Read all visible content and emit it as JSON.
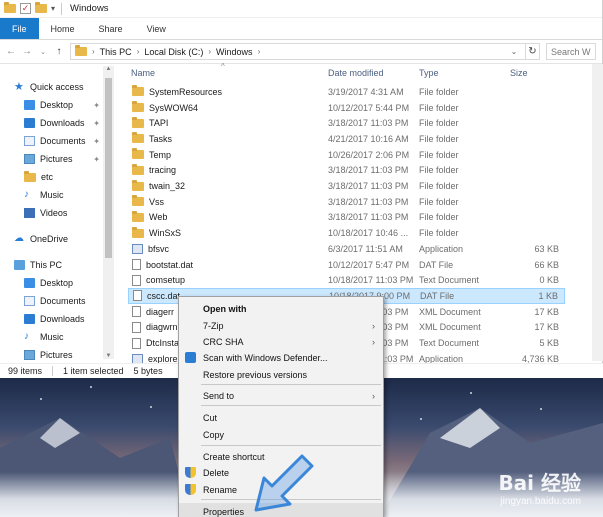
{
  "window": {
    "title": "Windows",
    "qa_check": "✓",
    "qa_dropdown": "▾"
  },
  "ribbon": {
    "tabs": [
      "File",
      "Home",
      "Share",
      "View"
    ]
  },
  "address": {
    "crumbs": [
      "This PC",
      "Local Disk (C:)",
      "Windows"
    ],
    "crumb_sep": "›",
    "dropdown": "⌄",
    "refresh": "↻",
    "search_placeholder": "Search W",
    "nav": {
      "back": "←",
      "forward": "→",
      "recent": "⌄",
      "up": "↑"
    }
  },
  "nav_pane": {
    "quick_access": "Quick access",
    "quick_items": [
      {
        "label": "Desktop",
        "icon": "desktop-icon"
      },
      {
        "label": "Downloads",
        "icon": "downloads-icon"
      },
      {
        "label": "Documents",
        "icon": "documents-icon"
      },
      {
        "label": "Pictures",
        "icon": "pictures-icon"
      },
      {
        "label": "etc",
        "icon": "folder-icon"
      },
      {
        "label": "Music",
        "icon": "music-icon"
      },
      {
        "label": "Videos",
        "icon": "videos-icon"
      }
    ],
    "onedrive": "OneDrive",
    "this_pc": "This PC",
    "pc_items": [
      {
        "label": "Desktop"
      },
      {
        "label": "Documents"
      },
      {
        "label": "Downloads"
      },
      {
        "label": "Music"
      },
      {
        "label": "Pictures"
      }
    ]
  },
  "columns": {
    "name": "Name",
    "date": "Date modified",
    "type": "Type",
    "size": "Size",
    "sort_indicator": "^"
  },
  "files": [
    {
      "name": "SystemResources",
      "date": "3/19/2017 4:31 AM",
      "type": "File folder",
      "size": "",
      "kind": "folder"
    },
    {
      "name": "SysWOW64",
      "date": "10/12/2017 5:44 PM",
      "type": "File folder",
      "size": "",
      "kind": "folder"
    },
    {
      "name": "TAPI",
      "date": "3/18/2017 11:03 PM",
      "type": "File folder",
      "size": "",
      "kind": "folder"
    },
    {
      "name": "Tasks",
      "date": "4/21/2017 10:16 AM",
      "type": "File folder",
      "size": "",
      "kind": "folder"
    },
    {
      "name": "Temp",
      "date": "10/26/2017 2:06 PM",
      "type": "File folder",
      "size": "",
      "kind": "folder"
    },
    {
      "name": "tracing",
      "date": "3/18/2017 11:03 PM",
      "type": "File folder",
      "size": "",
      "kind": "folder"
    },
    {
      "name": "twain_32",
      "date": "3/18/2017 11:03 PM",
      "type": "File folder",
      "size": "",
      "kind": "folder"
    },
    {
      "name": "Vss",
      "date": "3/18/2017 11:03 PM",
      "type": "File folder",
      "size": "",
      "kind": "folder"
    },
    {
      "name": "Web",
      "date": "3/18/2017 11:03 PM",
      "type": "File folder",
      "size": "",
      "kind": "folder"
    },
    {
      "name": "WinSxS",
      "date": "10/18/2017 10:46 ...",
      "type": "File folder",
      "size": "",
      "kind": "folder"
    },
    {
      "name": "bfsvc",
      "date": "6/3/2017 11:51 AM",
      "type": "Application",
      "size": "63 KB",
      "kind": "app"
    },
    {
      "name": "bootstat.dat",
      "date": "10/12/2017 5:47 PM",
      "type": "DAT File",
      "size": "66 KB",
      "kind": "file"
    },
    {
      "name": "comsetup",
      "date": "10/18/2017 11:03 PM",
      "type": "Text Document",
      "size": "0 KB",
      "kind": "file"
    },
    {
      "name": "cscc.dat",
      "date": "10/18/2017 9:00 PM",
      "type": "DAT File",
      "size": "1 KB",
      "kind": "file"
    },
    {
      "name": "diagerr",
      "date": "3/18/2017 11:03 PM",
      "type": "XML Document",
      "size": "17 KB",
      "kind": "file"
    },
    {
      "name": "diagwrn",
      "date": "3/18/2017 11:03 PM",
      "type": "XML Document",
      "size": "17 KB",
      "kind": "file"
    },
    {
      "name": "DtcInstall",
      "date": "3/18/2017 11:03 PM",
      "type": "Text Document",
      "size": "5 KB",
      "kind": "file"
    },
    {
      "name": "explorer",
      "date": "10/18/2017 11:03 PM",
      "type": "Application",
      "size": "4,736 KB",
      "kind": "app"
    }
  ],
  "status": {
    "count": "99 items",
    "selected": "1 item selected",
    "size": "5 bytes"
  },
  "context_menu": {
    "items": [
      {
        "label": "Open with",
        "bold": true,
        "sub": ""
      },
      {
        "label": "7-Zip",
        "sub": "›"
      },
      {
        "label": "CRC SHA",
        "sub": "›"
      },
      {
        "label": "Scan with Windows Defender...",
        "sub": "",
        "icon": "defender-icon"
      },
      {
        "label": "Restore previous versions",
        "sub": ""
      },
      {
        "label": "Send to",
        "sub": "›"
      },
      {
        "label": "Cut",
        "sub": ""
      },
      {
        "label": "Copy",
        "sub": ""
      },
      {
        "label": "Create shortcut",
        "sub": ""
      },
      {
        "label": "Delete",
        "sub": "",
        "icon": "shield-icon"
      },
      {
        "label": "Rename",
        "sub": "",
        "icon": "shield-icon"
      },
      {
        "label": "Properties",
        "sub": ""
      }
    ]
  },
  "watermark": {
    "logo": "Bai 经验",
    "url": "jingyan.baidu.com"
  }
}
